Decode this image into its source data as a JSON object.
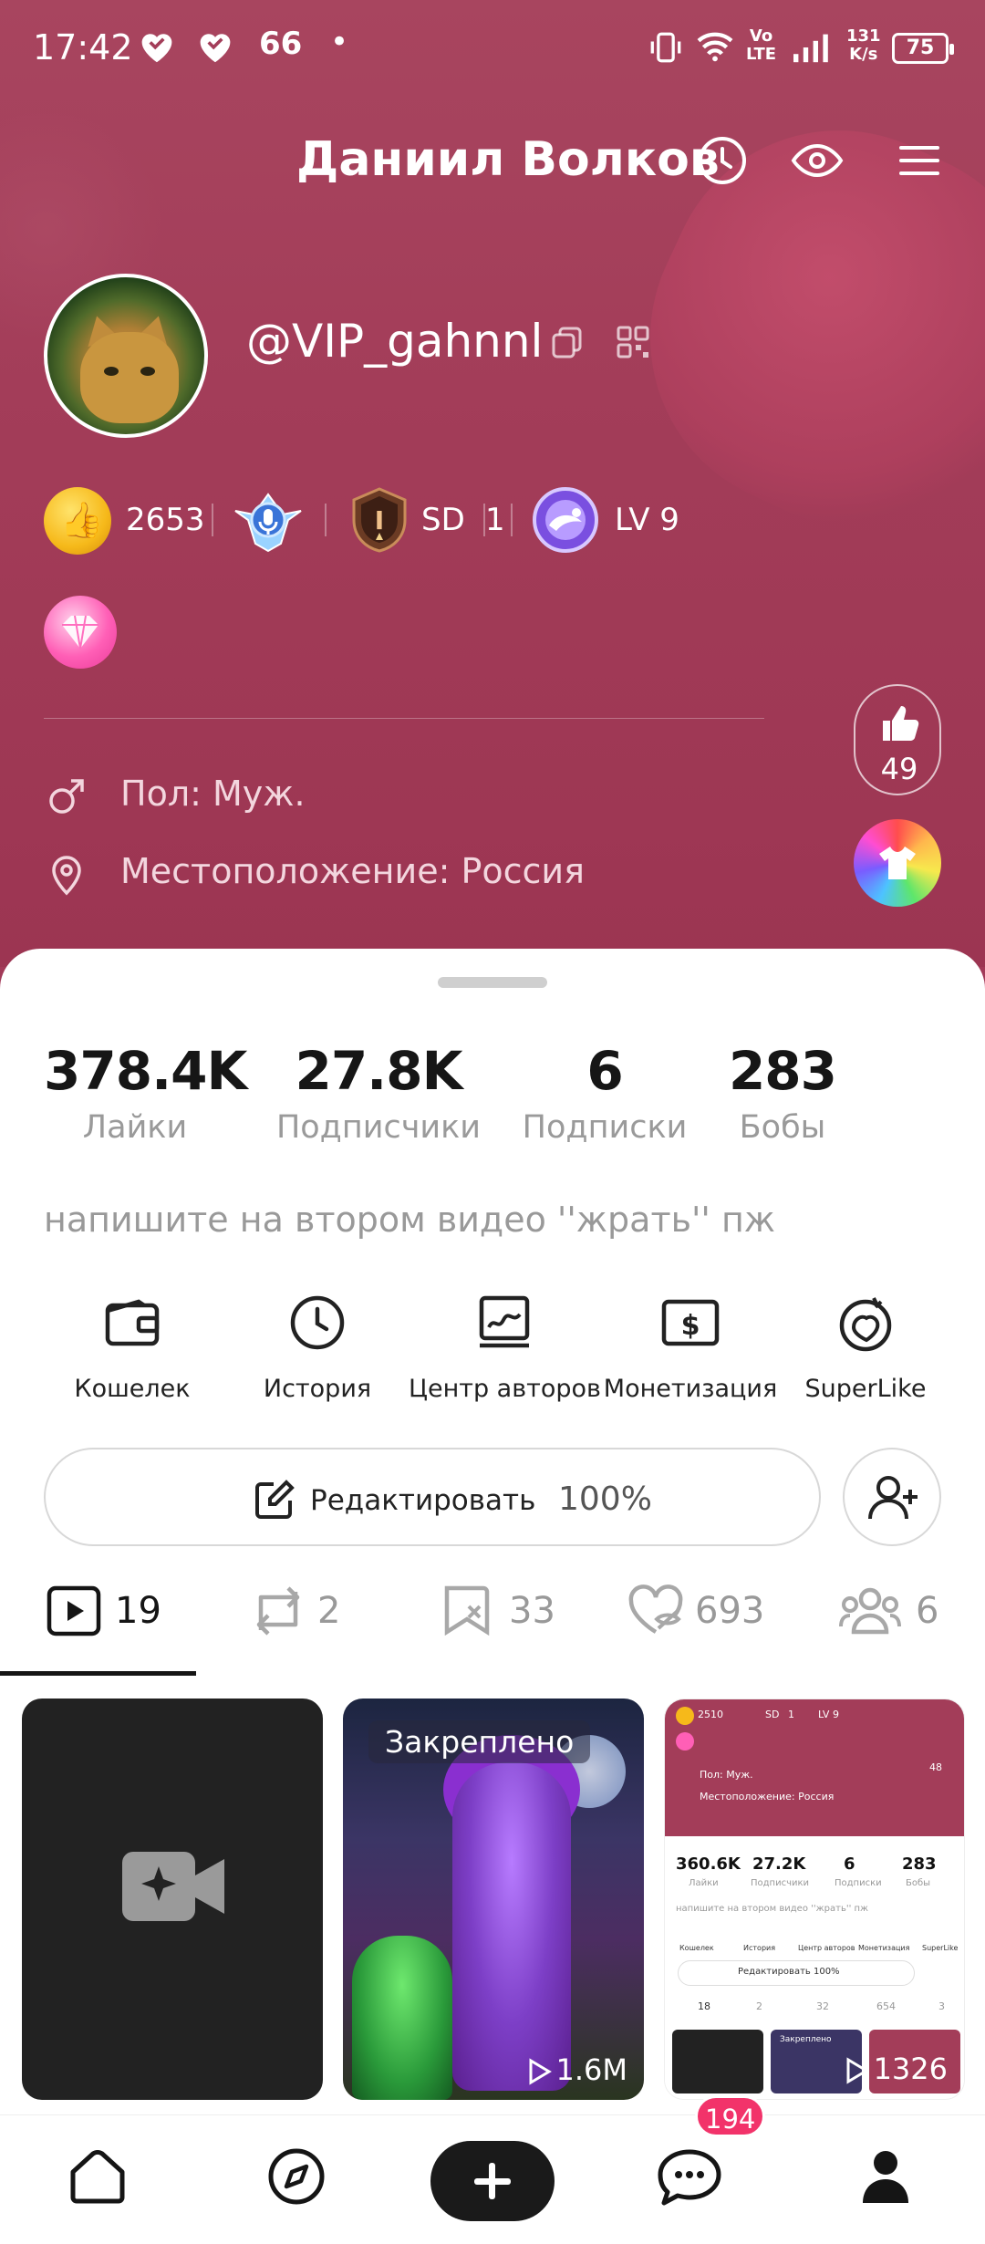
{
  "status_bar": {
    "time": "17:42",
    "net_speed_value": "131",
    "net_speed_unit": "K/s",
    "volte_top": "Vo",
    "volte_bottom": "LTE",
    "battery": "75"
  },
  "header": {
    "title": "Даниил Волков"
  },
  "profile": {
    "handle": "@VIP_gahnnl",
    "coins": "2653",
    "rank_label": "SD",
    "rank_value": "1",
    "level": "LV 9",
    "gender": "Пол: Муж.",
    "location": "Местоположение: Россия",
    "likes_received": "49"
  },
  "stats": [
    {
      "value": "378.4K",
      "label": "Лайки"
    },
    {
      "value": "27.8K",
      "label": "Подписчики"
    },
    {
      "value": "6",
      "label": "Подписки"
    },
    {
      "value": "283",
      "label": "Бобы"
    }
  ],
  "bio": "напишите на втором видео ''жрать'' пж",
  "tools": [
    {
      "label": "Кошелек",
      "icon": "wallet-icon"
    },
    {
      "label": "История",
      "icon": "clock-icon"
    },
    {
      "label": "Центр авторов",
      "icon": "chart-icon"
    },
    {
      "label": "Монетизация",
      "icon": "dollar-icon"
    },
    {
      "label": "SuperLike",
      "icon": "superlike-icon"
    }
  ],
  "edit": {
    "label": "Редактировать",
    "percent": "100%"
  },
  "tabs": [
    {
      "icon": "video-icon",
      "count": "19"
    },
    {
      "icon": "repost-icon",
      "count": "2"
    },
    {
      "icon": "bookmark-icon",
      "count": "33"
    },
    {
      "icon": "hidden-like-icon",
      "count": "693"
    },
    {
      "icon": "group-icon",
      "count": "6"
    }
  ],
  "videos": {
    "pinned_label": "Закреплено",
    "pinned_views": "1.6M",
    "third_views": "1326"
  },
  "mini_screenshot": {
    "coins": "2510",
    "rank": "SD",
    "rank_value": "1",
    "level": "LV 9",
    "gender": "Пол: Муж.",
    "location": "Местоположение: Россия",
    "likes": "48",
    "stats": [
      {
        "value": "360.6K",
        "label": "Лайки"
      },
      {
        "value": "27.2K",
        "label": "Подписчики"
      },
      {
        "value": "6",
        "label": "Подписки"
      },
      {
        "value": "283",
        "label": "Бобы"
      }
    ],
    "bio": "напишите на втором видео ''жрать'' пж",
    "tools": [
      "Кошелек",
      "История",
      "Центр авторов",
      "Монетизация",
      "SuperLike"
    ],
    "edit": "Редактировать 100%",
    "tab_counts": [
      "18",
      "2",
      "32",
      "654",
      "3"
    ],
    "pinned": "Закреплено"
  },
  "bottom_nav": {
    "messages_badge": "194"
  },
  "colors": {
    "header_bg": "#a33d59",
    "accent_badge": "#f2336a",
    "text_dark": "#161616",
    "text_muted": "#9a9a9a"
  }
}
